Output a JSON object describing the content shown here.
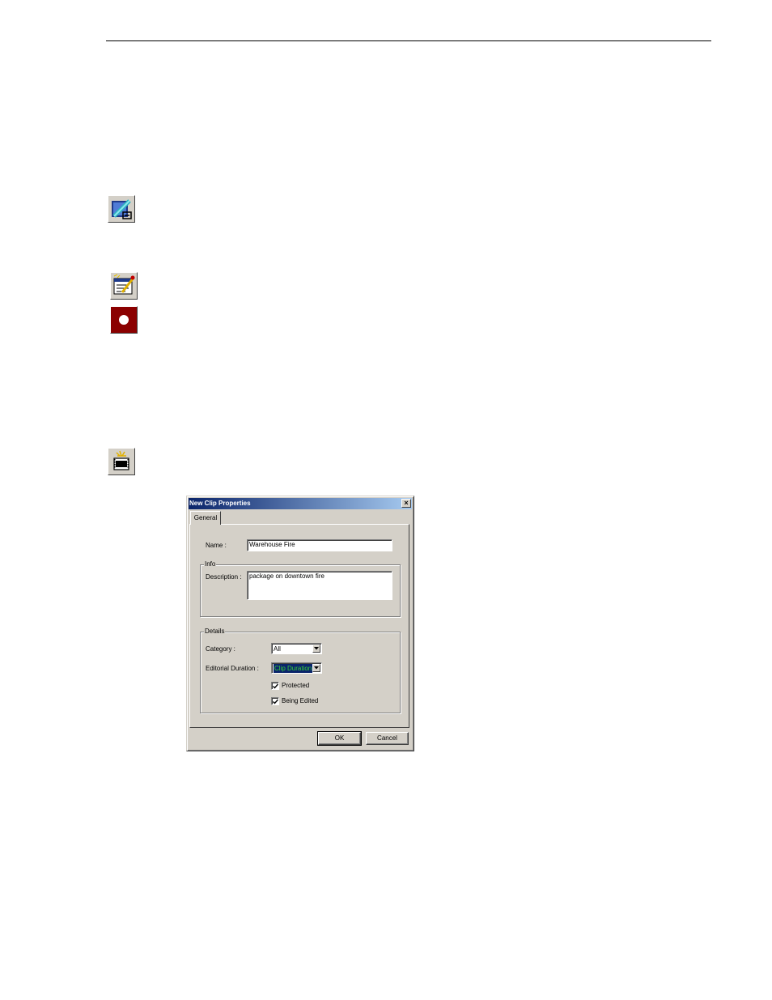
{
  "toolbar_icons": [
    {
      "name": "edit-tool-icon"
    },
    {
      "name": "clip-properties-icon"
    },
    {
      "name": "record-icon"
    },
    {
      "name": "new-clip-icon"
    }
  ],
  "dialog": {
    "title": "New Clip Properties",
    "close_symbol": "×",
    "tab_general": "General",
    "name_label": "Name :",
    "name_value": "Warehouse Fire",
    "info_legend": "Info",
    "description_label": "Description :",
    "description_value": "package on downtown fire",
    "details_legend": "Details",
    "category_label": "Category :",
    "category_value": "All",
    "editorial_duration_label": "Editorial Duration :",
    "editorial_duration_value": "Clip Duration",
    "protected_label": "Protected",
    "protected_checked": true,
    "being_edited_label": "Being Edited",
    "being_edited_checked": true,
    "ok_label": "OK",
    "cancel_label": "Cancel"
  },
  "colors": {
    "dialog_face": "#d4d0c8",
    "titlebar_start": "#0a246a",
    "titlebar_end": "#a6caf0",
    "record_red": "#8b0000",
    "selection_bg": "#0a246a",
    "selection_text": "#38d138"
  }
}
